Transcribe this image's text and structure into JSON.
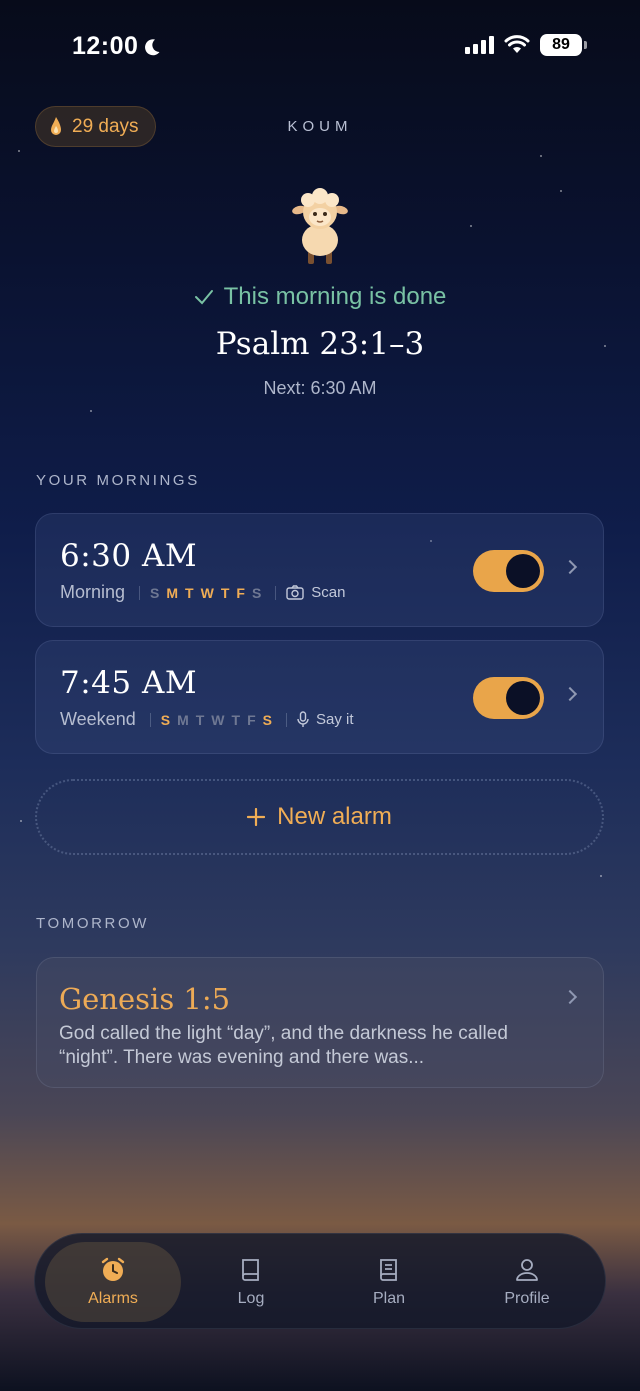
{
  "status_bar": {
    "time": "12:00",
    "battery": "89"
  },
  "header": {
    "streak": "29 days",
    "brand": "KOUM"
  },
  "today": {
    "status": "This morning is done",
    "verse_ref": "Psalm 23:1–3",
    "next": "Next: 6:30 AM"
  },
  "mornings": {
    "label": "YOUR MORNINGS",
    "alarms": [
      {
        "time": "6:30 AM",
        "name": "Morning",
        "days": [
          {
            "d": "S",
            "on": false
          },
          {
            "d": "M",
            "on": true
          },
          {
            "d": "T",
            "on": true
          },
          {
            "d": "W",
            "on": true
          },
          {
            "d": "T",
            "on": true
          },
          {
            "d": "F",
            "on": true
          },
          {
            "d": "S",
            "on": false
          }
        ],
        "mode": "Scan",
        "mode_icon": "camera-icon",
        "enabled": true
      },
      {
        "time": "7:45 AM",
        "name": "Weekend",
        "days": [
          {
            "d": "S",
            "on": true
          },
          {
            "d": "M",
            "on": false
          },
          {
            "d": "T",
            "on": false
          },
          {
            "d": "W",
            "on": false
          },
          {
            "d": "T",
            "on": false
          },
          {
            "d": "F",
            "on": false
          },
          {
            "d": "S",
            "on": true
          }
        ],
        "mode": "Say it",
        "mode_icon": "microphone-icon",
        "enabled": true
      }
    ],
    "new_alarm": "New alarm"
  },
  "tomorrow": {
    "label": "TOMORROW",
    "verse_ref": "Genesis 1:5",
    "text": "God called the light “day”, and the darkness he called “night”. There was evening and there was..."
  },
  "tabs": [
    {
      "label": "Alarms",
      "icon": "alarm-clock-icon",
      "active": true
    },
    {
      "label": "Log",
      "icon": "book-icon",
      "active": false
    },
    {
      "label": "Plan",
      "icon": "plan-book-icon",
      "active": false
    },
    {
      "label": "Profile",
      "icon": "person-icon",
      "active": false
    }
  ],
  "colors": {
    "accent": "#f0ad55",
    "success": "#79c2a4",
    "toggle_on": "#e9a54a"
  }
}
